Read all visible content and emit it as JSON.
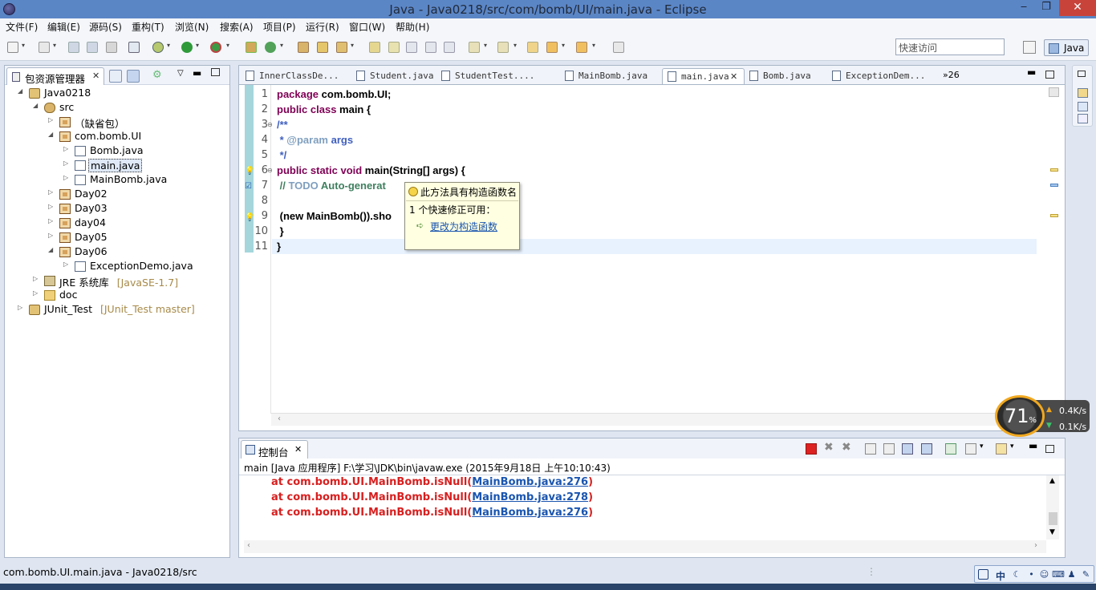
{
  "window": {
    "title": "Java - Java0218/src/com/bomb/UI/main.java - Eclipse",
    "min": "‒",
    "max": "❐",
    "close": "✕"
  },
  "menu": [
    "文件(F)",
    "编辑(E)",
    "源码(S)",
    "重构(T)",
    "浏览(N)",
    "搜索(A)",
    "项目(P)",
    "运行(R)",
    "窗口(W)",
    "帮助(H)"
  ],
  "toolbar": {
    "quick_access_placeholder": "快速访问",
    "perspective": "Java"
  },
  "package_explorer": {
    "tab_label": "包资源管理器",
    "tree": [
      {
        "label": "Java0218",
        "twisty": "◢",
        "icon": "project-icon",
        "decoration": ""
      },
      {
        "label": "src",
        "twisty": "◢",
        "icon": "source-folder-icon",
        "decoration": ""
      },
      {
        "label": "（缺省包）",
        "twisty": "▷",
        "icon": "package-icon",
        "decoration": ""
      },
      {
        "label": "com.bomb.UI",
        "twisty": "◢",
        "icon": "package-icon",
        "decoration": ""
      },
      {
        "label": "Bomb.java",
        "twisty": "▷",
        "icon": "java-file-icon",
        "decoration": ""
      },
      {
        "label": "main.java",
        "twisty": "▷",
        "icon": "java-file-icon",
        "decoration": ""
      },
      {
        "label": "MainBomb.java",
        "twisty": "▷",
        "icon": "java-file-icon",
        "decoration": ""
      },
      {
        "label": "Day02",
        "twisty": "▷",
        "icon": "package-icon",
        "decoration": ""
      },
      {
        "label": "Day03",
        "twisty": "▷",
        "icon": "package-icon",
        "decoration": ""
      },
      {
        "label": "day04",
        "twisty": "▷",
        "icon": "package-icon",
        "decoration": ""
      },
      {
        "label": "Day05",
        "twisty": "▷",
        "icon": "package-icon",
        "decoration": ""
      },
      {
        "label": "Day06",
        "twisty": "◢",
        "icon": "package-icon",
        "decoration": ""
      },
      {
        "label": "ExceptionDemo.java",
        "twisty": "▷",
        "icon": "java-file-icon",
        "decoration": ""
      },
      {
        "label": "JRE 系统库",
        "twisty": "▷",
        "icon": "library-icon",
        "decoration": "[JavaSE-1.7]"
      },
      {
        "label": "doc",
        "twisty": "▷",
        "icon": "folder-icon",
        "decoration": ""
      },
      {
        "label": "JUnit_Test",
        "twisty": "▷",
        "icon": "project-icon",
        "decoration": "[JUnit_Test master]"
      }
    ]
  },
  "editor": {
    "tabs": [
      "InnerClassDe...",
      "Student.java",
      "StudentTest....",
      "MainBomb.java",
      "main.java",
      "Bomb.java",
      "ExceptionDem..."
    ],
    "active_tab": "main.java",
    "more_tabs": "»26",
    "line_numbers": [
      "1",
      "2",
      "3",
      "4",
      "5",
      "6",
      "7",
      "8",
      "9",
      "10",
      "11"
    ],
    "code": {
      "l1_kw": "package",
      "l1_rest": " com.bomb.UI;",
      "l2_kw": "public class",
      "l2_rest": " main {",
      "l3": "/**",
      "l4_pre": " * ",
      "l4_tag": "@param",
      "l4_rest": " args",
      "l5": " */",
      "l6_kw": "public static void",
      "l6_rest": " main(String[] args) {",
      "l7_pre": " // ",
      "l7_todo": "TODO",
      "l7_rest": " Auto-generat",
      "l8": "",
      "l9": " (new MainBomb()).sho",
      "l10": " }",
      "l11": "}"
    },
    "tooltip": {
      "title": "此方法具有构造函数名",
      "body": "1 个快速修正可用：",
      "fix": "更改为构造函数"
    }
  },
  "console": {
    "tab_label": "控制台",
    "description": "main [Java 应用程序] F:\\学习\\JDK\\bin\\javaw.exe (2015年9月18日 上午10:10:43)",
    "lines": [
      {
        "text": "at com.bomb.UI.MainBomb.isNull(",
        "link": "MainBomb.java:276",
        "tail": ")"
      },
      {
        "text": "at com.bomb.UI.MainBomb.isNull(",
        "link": "MainBomb.java:278",
        "tail": ")"
      },
      {
        "text": "at com.bomb.UI.MainBomb.isNull(",
        "link": "MainBomb.java:276",
        "tail": ")"
      }
    ]
  },
  "status": {
    "text": "com.bomb.UI.main.java - Java0218/src"
  },
  "net_widget": {
    "percent": "71",
    "percent_sign": "%",
    "upload": "0.4K/s",
    "download": "0.1K/s"
  },
  "ime": [
    "中"
  ],
  "colors": {
    "keyword": "#7f0055",
    "comment": "#3f7f5f",
    "javadoc": "#3f5fbf",
    "error": "#d81f1f",
    "link": "#1a55b0",
    "titlebar": "#5b86c6"
  }
}
